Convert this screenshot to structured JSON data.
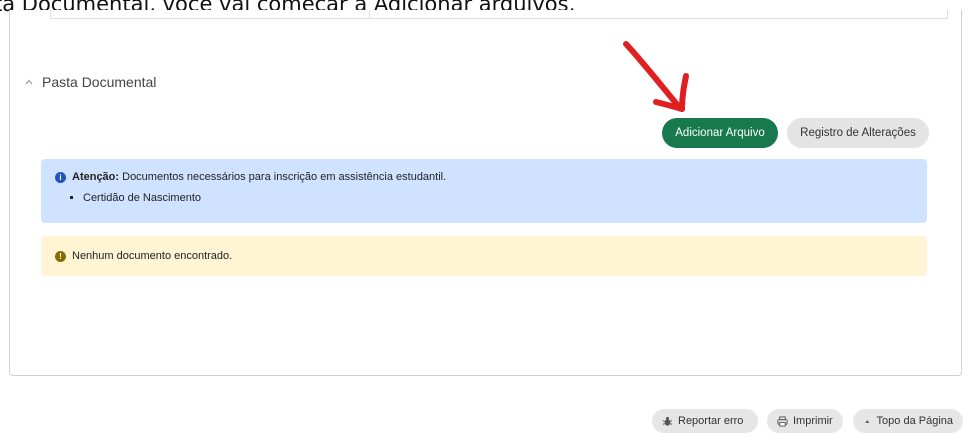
{
  "caption": {
    "text": "ta Documental, você vai começar a Adicionar arquivos,"
  },
  "section": {
    "title": "Pasta Documental"
  },
  "actions": {
    "add_file": "Adicionar Arquivo",
    "change_log": "Registro de Alterações"
  },
  "alert_info": {
    "label": "Atenção:",
    "message": "Documentos necessários para inscrição em assistência estudantil.",
    "items": [
      "Certidão de Nascimento"
    ],
    "color": "#cfe2ff"
  },
  "alert_warning": {
    "message": "Nenhum documento encontrado.",
    "color": "#fff4d4"
  },
  "footer": {
    "report_error": "Reportar erro",
    "print": "Imprimir",
    "page_top": "Topo da Página"
  },
  "colors": {
    "primary_button": "#18794e",
    "secondary_button": "#e4e4e4",
    "annotation_arrow": "#e02020"
  },
  "icons": [
    "chevron-up-icon",
    "info-icon",
    "warning-icon",
    "bug-icon",
    "printer-icon",
    "caret-up-icon",
    "hand-drawn-arrow"
  ]
}
